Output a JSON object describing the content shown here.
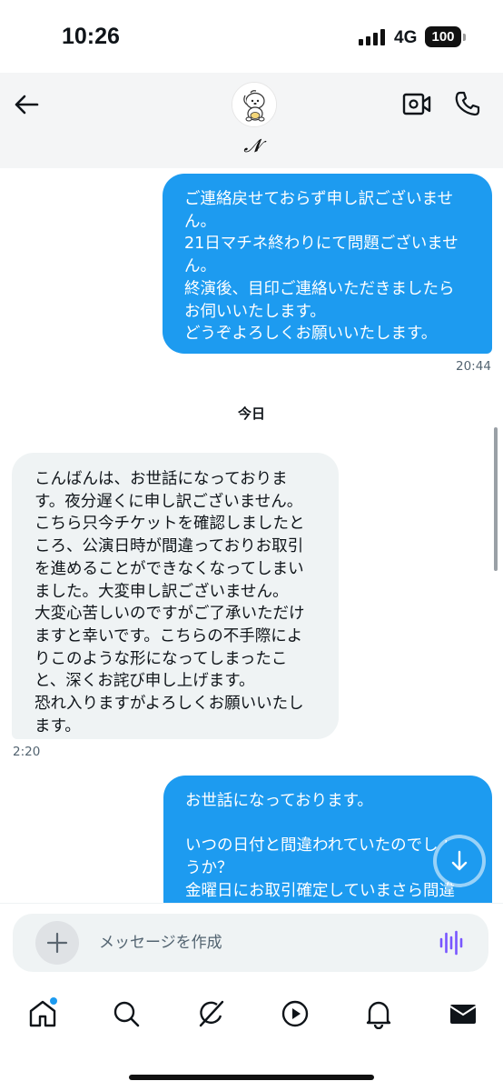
{
  "status_bar": {
    "time": "10:26",
    "network": "4G",
    "battery": "100"
  },
  "header": {
    "contact_name": "𝓝",
    "back_icon": "arrow-left-icon",
    "video_icon": "video-call-icon",
    "phone_icon": "phone-icon"
  },
  "messages": [
    {
      "direction": "outgoing",
      "text": "ご連絡戻せておらず申し訳ございませ\nん。\n21日マチネ終わりにて問題ございませ\nん。\n終演後、目印ご連絡いただきましたら\nお伺いいたします。\nどうぞよろしくお願いいたします。",
      "time": "20:44"
    },
    {
      "direction": "incoming",
      "text": "こんばんは、お世話になっておりま\nす。夜分遅くに申し訳ございません。\nこちら只今チケットを確認しましたと\nころ、公演日時が間違っておりお取引\nを進めることができなくなってしまい\nました。大変申し訳ございません。\n大変心苦しいのですがご了承いただけ\nますと幸いです。こちらの不手際によ\nりこのような形になってしまったこ\nと、深くお詫び申し上げます。\n恐れ入りますがよろしくお願いいたし\nます。",
      "time": "2:20"
    },
    {
      "direction": "outgoing",
      "text": "お世話になっております。\n\nいつの日付と間違われていたのでしょ\nうか？\n金曜日にお取引確定していまさら間違\nえたとおっしゃっていますか？ご"
    }
  ],
  "day_separator": "今日",
  "composer": {
    "placeholder": "メッセージを作成"
  },
  "colors": {
    "accent": "#1d9bf0",
    "incoming_bubble": "#eff3f4",
    "voice_icon": "#7856ff"
  },
  "tabs": [
    {
      "name": "home-icon"
    },
    {
      "name": "search-icon"
    },
    {
      "name": "grok-icon"
    },
    {
      "name": "video-play-icon"
    },
    {
      "name": "bell-icon"
    },
    {
      "name": "mail-icon"
    }
  ]
}
